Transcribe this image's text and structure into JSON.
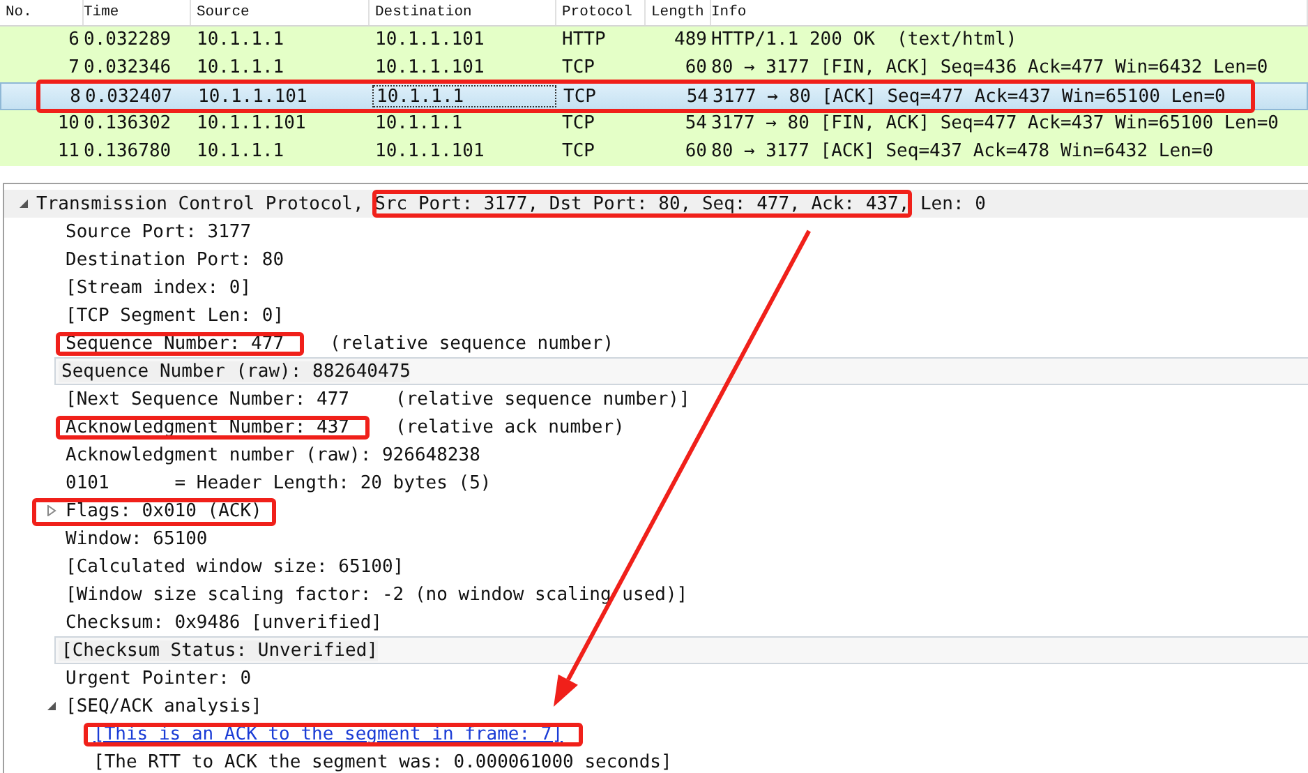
{
  "packet_list": {
    "columns": [
      "No.",
      "Time",
      "Source",
      "Destination",
      "Protocol",
      "Length",
      "Info"
    ],
    "rows": [
      {
        "cells": [
          "6",
          "0.032289",
          "10.1.1.1",
          "10.1.1.101",
          "HTTP",
          "489",
          "HTTP/1.1 200 OK  (text/html)"
        ],
        "selected": false,
        "boxed": false
      },
      {
        "cells": [
          "7",
          "0.032346",
          "10.1.1.1",
          "10.1.1.101",
          "TCP",
          "60",
          "80 → 3177 [FIN, ACK] Seq=436 Ack=477 Win=6432 Len=0"
        ],
        "selected": false,
        "boxed": false
      },
      {
        "cells": [
          "8",
          "0.032407",
          "10.1.1.101",
          "10.1.1.1",
          "TCP",
          "54",
          "3177 → 80 [ACK] Seq=477 Ack=437 Win=65100 Len=0"
        ],
        "selected": true,
        "boxed": true
      },
      {
        "cells": [
          "10",
          "0.136302",
          "10.1.1.101",
          "10.1.1.1",
          "TCP",
          "54",
          "3177 → 80 [FIN, ACK] Seq=477 Ack=437 Win=65100 Len=0"
        ],
        "selected": false,
        "boxed": false
      },
      {
        "cells": [
          "11",
          "0.136780",
          "10.1.1.1",
          "10.1.1.101",
          "TCP",
          "60",
          "80 → 3177 [ACK] Seq=437 Ack=478 Win=6432 Len=0"
        ],
        "selected": false,
        "boxed": false
      }
    ]
  },
  "details": [
    {
      "parts": [
        {
          "text": "Transmission Control Protocol, "
        },
        {
          "text": "Src Port: 3177, Dst Port: 80, Seq: 477, Ack: 437,",
          "boxed": true,
          "arrow_from": true
        },
        {
          "text": " Len: 0"
        }
      ],
      "expanded": true,
      "highlighted": true,
      "children": [
        {
          "text": "Source Port: 3177"
        },
        {
          "text": "Destination Port: 80"
        },
        {
          "text": "[Stream index: 0]"
        },
        {
          "text": "[TCP Segment Len: 0]"
        },
        {
          "text": "Sequence Number: 477",
          "note": "(relative sequence number)",
          "boxed": true
        },
        {
          "text": "Sequence Number (raw): 882640475",
          "highlighted": true
        },
        {
          "text": "[Next Sequence Number: 477",
          "note": "(relative sequence number)]"
        },
        {
          "text": "Acknowledgment Number: 437",
          "note": "(relative ack number)",
          "boxed": true
        },
        {
          "text": "Acknowledgment number (raw): 926648238"
        },
        {
          "text": "0101      = Header Length: 20 bytes (5)"
        },
        {
          "text": "Flags: 0x010 (ACK)",
          "expanded": false,
          "boxed": true
        },
        {
          "text": "Window: 65100"
        },
        {
          "text": "[Calculated window size: 65100]"
        },
        {
          "text": "[Window size scaling factor: -2 (no window scaling used)]"
        },
        {
          "text": "Checksum: 0x9486 [unverified]"
        },
        {
          "text": "[Checksum Status: Unverified]",
          "highlighted": true
        },
        {
          "text": "Urgent Pointer: 0"
        },
        {
          "text": "[SEQ/ACK analysis]",
          "expanded": true,
          "children": [
            {
              "text": "[This is an ACK to the segment in frame: 7]",
              "kind": "link",
              "boxed": true,
              "arrow_to": true
            },
            {
              "text": "[The RTT to ACK the segment was: 0.000061000 seconds]"
            }
          ]
        }
      ]
    }
  ]
}
